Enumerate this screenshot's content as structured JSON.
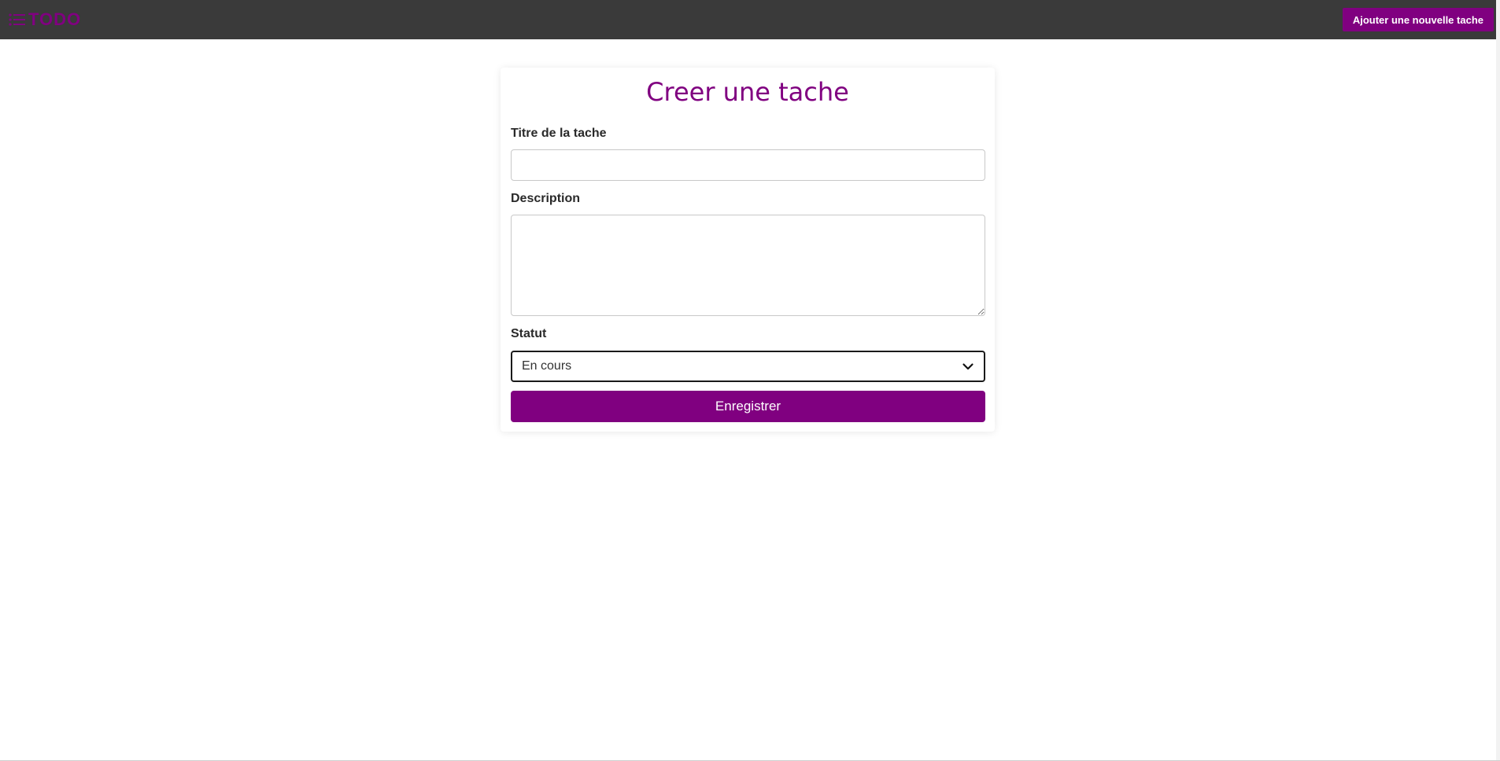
{
  "app": {
    "brand_text": "TODO",
    "brand_icon": "list-icon",
    "add_task_label": "Ajouter une nouvelle tache"
  },
  "form": {
    "title": "Creer une tache",
    "task_title_label": "Titre de la tache",
    "task_title_value": "",
    "description_label": "Description",
    "description_value": "",
    "status_label": "Statut",
    "status_value": "En cours",
    "save_label": "Enregistrer"
  },
  "colors": {
    "accent": "#800080",
    "topbar": "#3a3a3a"
  }
}
